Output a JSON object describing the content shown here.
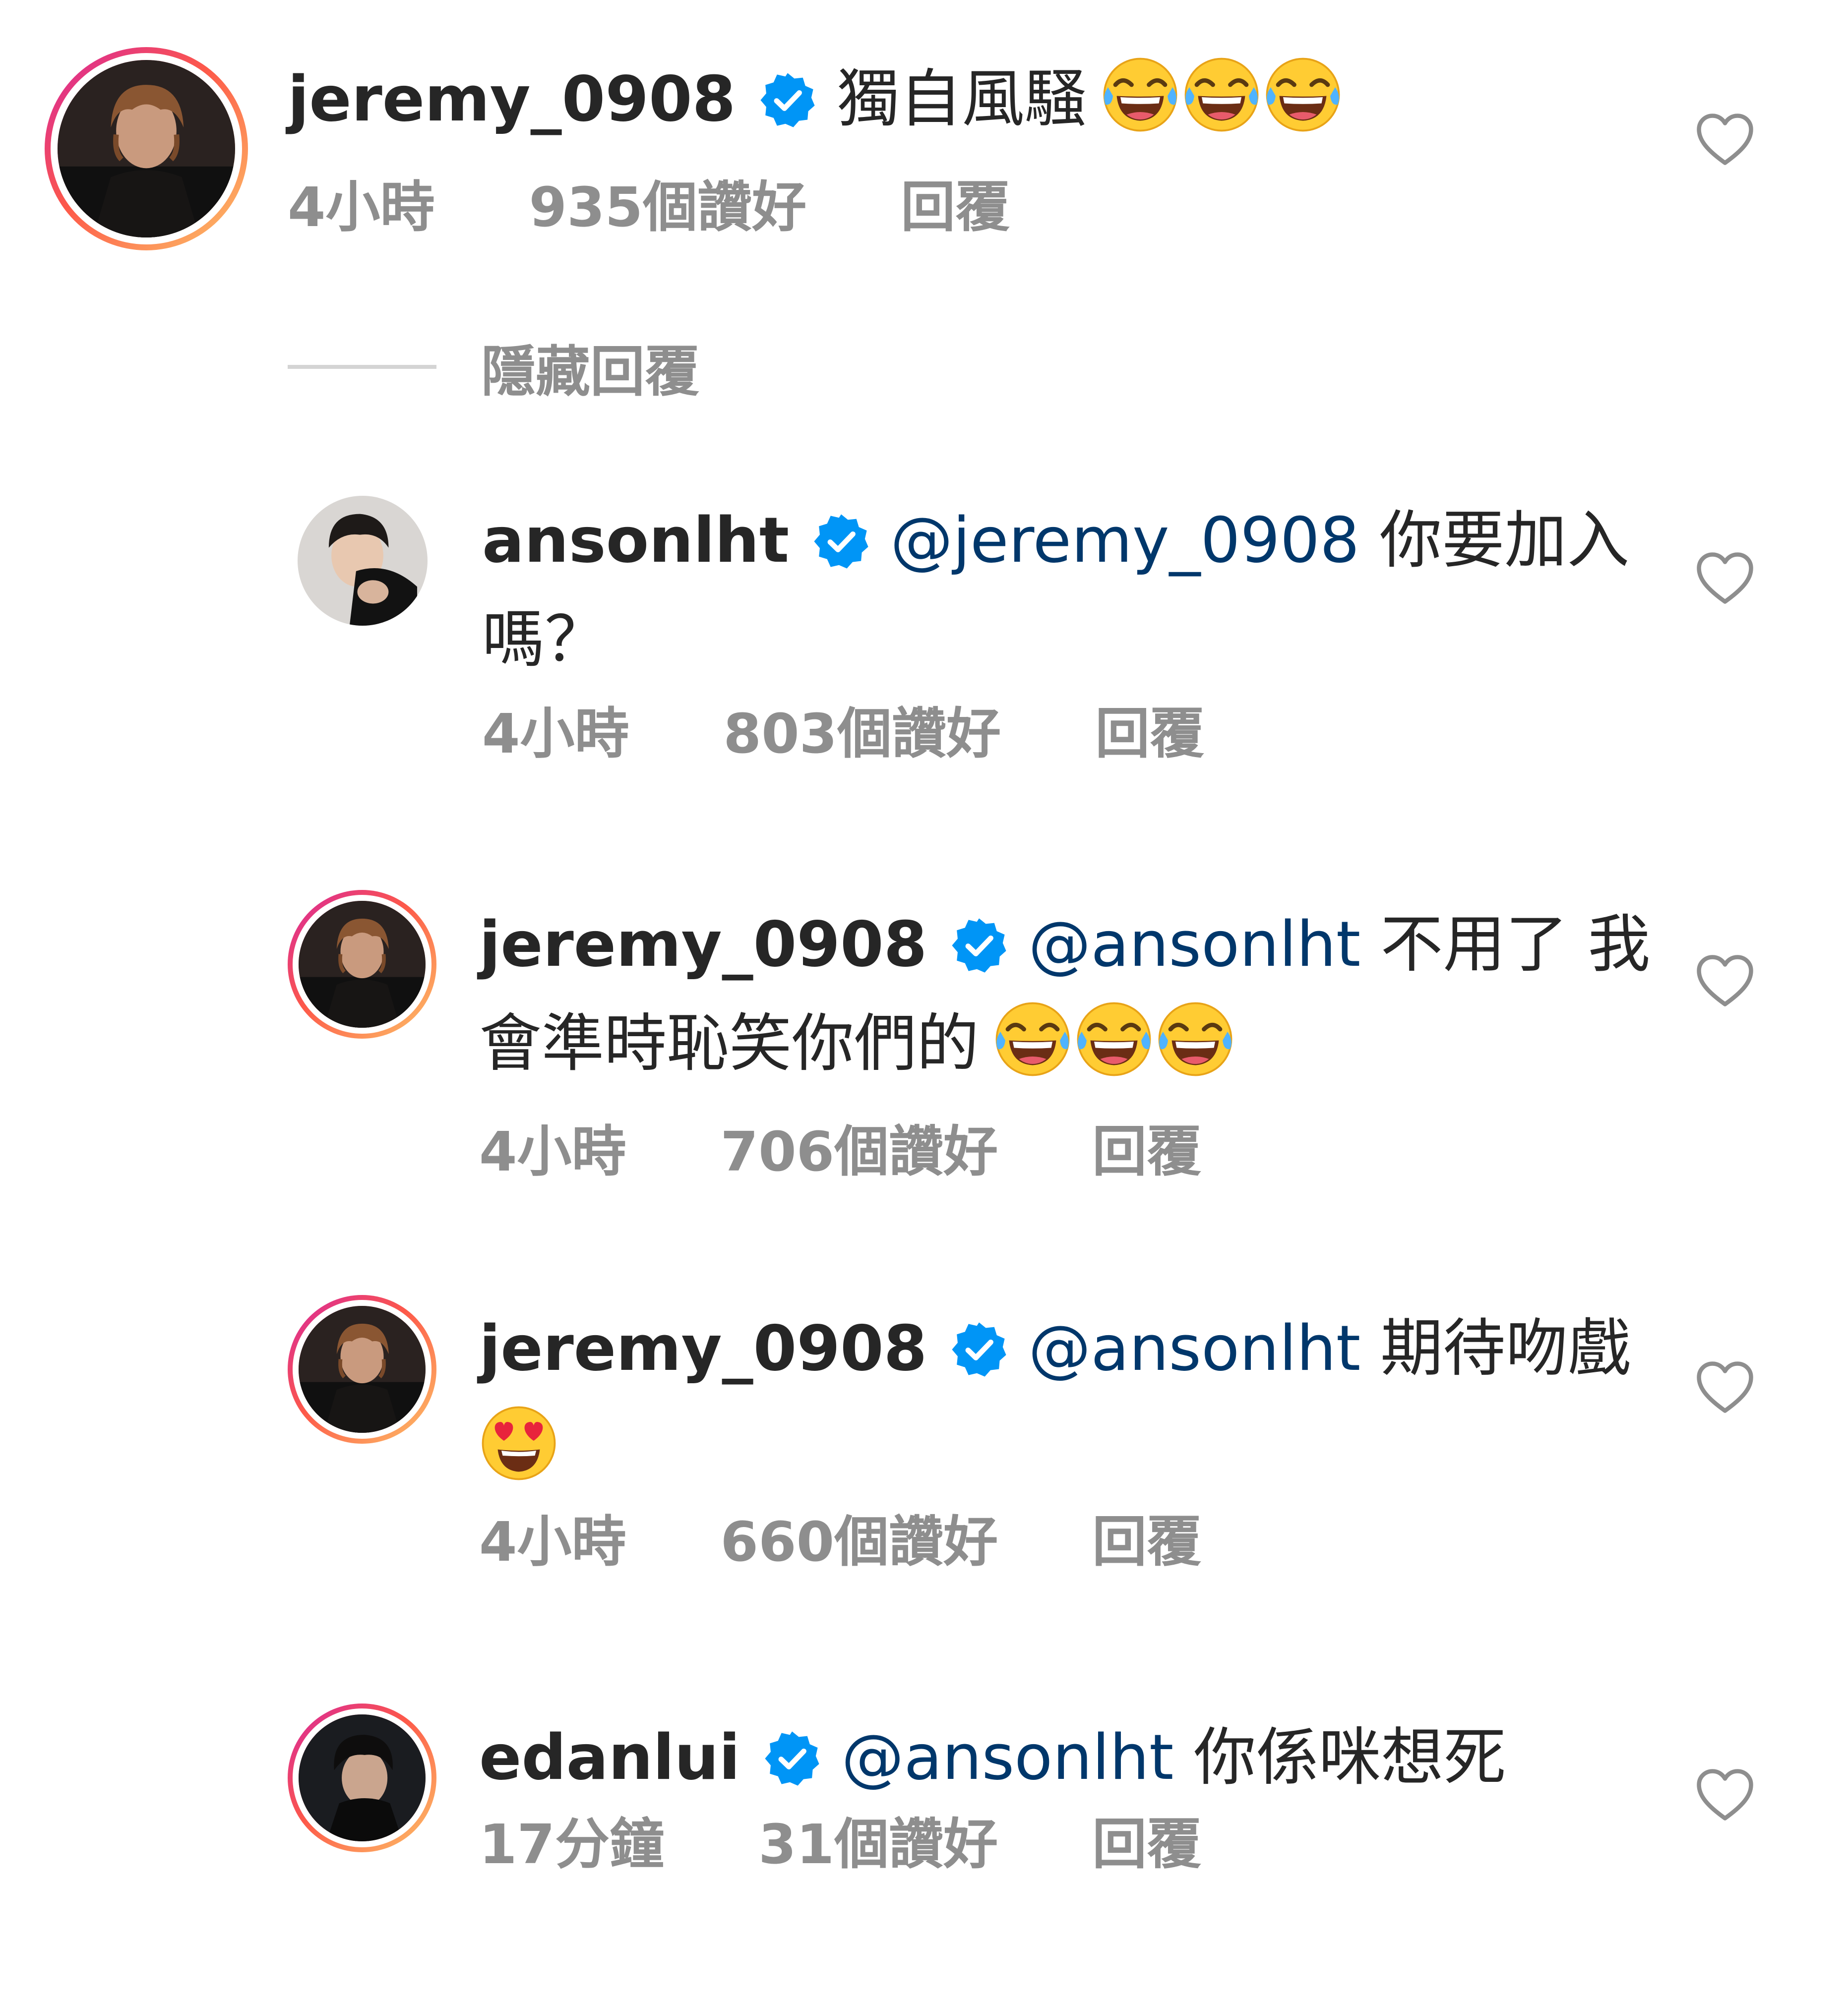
{
  "hide_replies_label": "隱藏回覆",
  "comments": [
    {
      "username": "jeremy_0908",
      "mention": "",
      "text_line1": "獨自風騷",
      "text_line2": "",
      "emoji": "face-with-tears-of-joy x3",
      "time": "4小時",
      "likes": "935個讚好",
      "reply": "回覆"
    },
    {
      "username": "ansonlht",
      "mention": "@jeremy_0908",
      "text_line1": "你要加入",
      "text_line2": "嗎？",
      "time": "4小時",
      "likes": "803個讚好",
      "reply": "回覆"
    },
    {
      "username": "jeremy_0908",
      "mention": "@ansonlht",
      "text_line1": "不用了 我",
      "text_line2": "會準時恥笑你們的",
      "emoji": "face-with-tears-of-joy x3",
      "time": "4小時",
      "likes": "706個讚好",
      "reply": "回覆"
    },
    {
      "username": "jeremy_0908",
      "mention": "@ansonlht",
      "text_line1": "期待吻戲",
      "text_line2": "",
      "emoji": "smiling-face-with-heart-eyes",
      "time": "4小時",
      "likes": "660個讚好",
      "reply": "回覆"
    },
    {
      "username": "edanlui",
      "mention": "@ansonlht",
      "text_line1": "你係咪想死",
      "text_line2": "",
      "time": "17分鐘",
      "likes": "31個讚好",
      "reply": "回覆"
    }
  ],
  "colors": {
    "text": "#262626",
    "meta": "#8e8e8e",
    "mention": "#00376b",
    "verified": "#0095f6"
  },
  "icons": [
    "verified-badge-icon",
    "heart-outline-icon",
    "laughing-emoji-icon",
    "heart-eyes-emoji-icon"
  ]
}
